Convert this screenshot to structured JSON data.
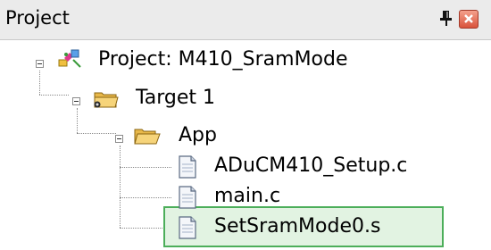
{
  "panel": {
    "title": "Project",
    "pin_icon": "pin-icon",
    "close_icon": "close-icon",
    "accent_selected": "#4cae5a"
  },
  "tree": {
    "root": {
      "label": "Project: M410_SramMode",
      "icon": "project-icon",
      "expanded": true,
      "children": [
        {
          "label": "Target 1",
          "icon": "target-folder-icon",
          "expanded": true,
          "children": [
            {
              "label": "App",
              "icon": "folder-open-icon",
              "expanded": true,
              "children": [
                {
                  "label": "ADuCM410_Setup.c",
                  "icon": "file-icon"
                },
                {
                  "label": "main.c",
                  "icon": "file-icon"
                },
                {
                  "label": "SetSramMode0.s",
                  "icon": "file-icon",
                  "selected": true
                }
              ]
            }
          ]
        }
      ]
    }
  }
}
